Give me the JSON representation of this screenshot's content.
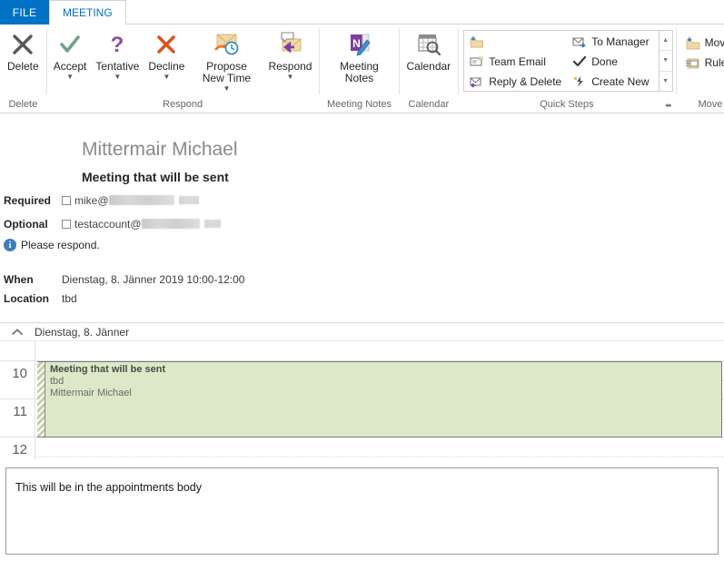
{
  "tabs": {
    "file": "FILE",
    "meeting": "MEETING"
  },
  "ribbon": {
    "groups": [
      {
        "name": "delete",
        "label": "Delete",
        "buttons": [
          {
            "label": "Delete",
            "icon": "delete-x-icon",
            "caret": false
          }
        ]
      },
      {
        "name": "respond",
        "label": "Respond",
        "buttons": [
          {
            "label": "Accept",
            "icon": "accept-check-icon",
            "caret": true
          },
          {
            "label": "Tentative",
            "icon": "tentative-question-icon",
            "caret": true
          },
          {
            "label": "Decline",
            "icon": "decline-x-icon",
            "caret": true
          },
          {
            "label": "Propose New Time",
            "icon": "propose-new-time-icon",
            "caret": true
          },
          {
            "label": "Respond",
            "icon": "respond-icon",
            "caret": true
          }
        ]
      },
      {
        "name": "meeting-notes",
        "label": "Meeting Notes",
        "buttons": [
          {
            "label": "Meeting Notes",
            "icon": "onenote-icon",
            "caret": false
          }
        ]
      },
      {
        "name": "calendar",
        "label": "Calendar",
        "buttons": [
          {
            "label": "Calendar",
            "icon": "calendar-search-icon",
            "caret": false
          }
        ]
      }
    ],
    "quick_steps": {
      "label": "Quick Steps",
      "items": [
        {
          "label": "",
          "icon": "move-to-folder-icon"
        },
        {
          "label": "To Manager",
          "icon": "to-manager-icon"
        },
        {
          "label": "Team Email",
          "icon": "team-email-icon"
        },
        {
          "label": "Done",
          "icon": "done-check-icon"
        },
        {
          "label": "Reply & Delete",
          "icon": "reply-delete-icon"
        },
        {
          "label": "Create New",
          "icon": "create-new-icon"
        }
      ],
      "scroll_up": "▲",
      "scroll_down": "▼",
      "scroll_more": "▼",
      "dialog_launcher": "⬌"
    },
    "move": {
      "label": "Move",
      "items": [
        {
          "label": "Move",
          "icon": "move-folder-icon",
          "caret": "▾"
        },
        {
          "label": "Rules",
          "icon": "rules-icon",
          "caret": "▾"
        }
      ]
    }
  },
  "message": {
    "organizer": "Mittermair Michael",
    "subject": "Meeting that will be sent",
    "required_label": "Required",
    "optional_label": "Optional",
    "required_value": "mike@",
    "optional_value": "testaccount@",
    "info_text": "Please respond.",
    "when_label": "When",
    "when_value": "Dienstag, 8. Jänner 2019 10:00-12:00",
    "location_label": "Location",
    "location_value": "tbd"
  },
  "day_preview": {
    "collapse_icon": "˄",
    "day_text": "Dienstag, 8. Jänner",
    "hours": [
      "10",
      "11",
      "12"
    ],
    "appointment": {
      "title": "Meeting that will be sent",
      "location": "tbd",
      "organizer": "Mittermair Michael"
    }
  },
  "body": {
    "text": "This will be in the appointments body"
  },
  "colors": {
    "accent_blue": "#0072c6",
    "appointment_green": "#dde8c8",
    "accept_green": "#6fa287",
    "tentative_purple": "#8b4f9f",
    "decline_red": "#d9541e",
    "info_blue": "#3d7ebd"
  }
}
